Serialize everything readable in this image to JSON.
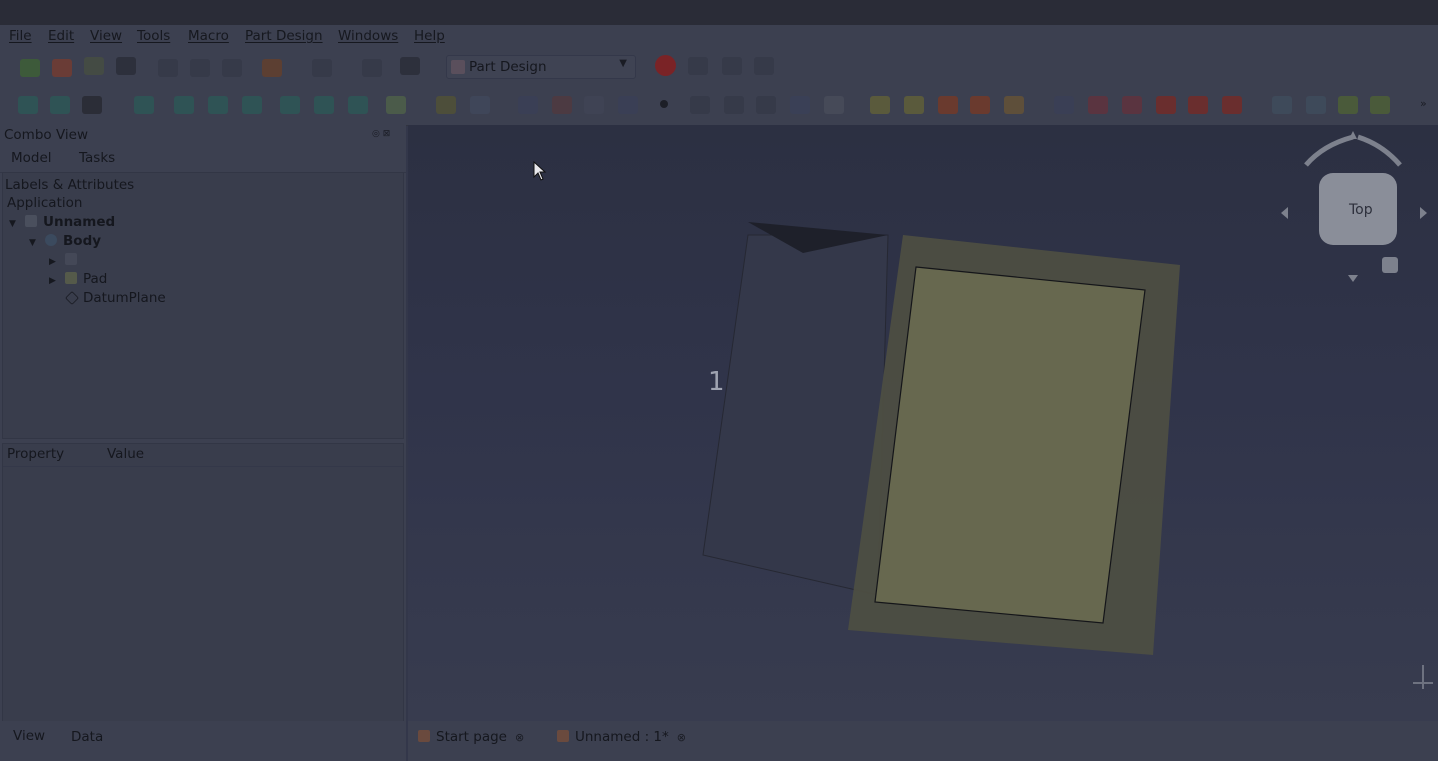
{
  "menu": {
    "file": "File",
    "edit": "Edit",
    "view": "View",
    "tools": "Tools",
    "macro": "Macro",
    "part_design": "Part Design",
    "windows": "Windows",
    "help": "Help"
  },
  "toolbar": {
    "workbench": "Part Design",
    "workbench_icon": "part-design-icon",
    "record_icon": "record-macro-icon"
  },
  "combo": {
    "title": "Combo View",
    "tab_model": "Model",
    "tab_tasks": "Tasks",
    "labels_header": "Labels & Attributes",
    "application": "Application",
    "tree": [
      {
        "label": "Unnamed",
        "bold": true,
        "icon": "document-icon"
      },
      {
        "label": "Body",
        "bold": true,
        "icon": "body-icon"
      },
      {
        "label": "",
        "icon": "origin-icon"
      },
      {
        "label": "Pad",
        "icon": "pad-icon"
      },
      {
        "label": "DatumPlane",
        "icon": "datum-plane-icon"
      }
    ],
    "property_header": "Property",
    "value_header": "Value",
    "bottom_tab_view": "View",
    "bottom_tab_data": "Data"
  },
  "viewport": {
    "dimension_label": "1",
    "navcube_face": "Top"
  },
  "doc_tabs": [
    {
      "label": "Start page"
    },
    {
      "label": "Unnamed : 1*"
    }
  ],
  "colors": {
    "background": "#33374a",
    "pad_face": "#67684f",
    "datum_plane": "#4d4e42"
  }
}
